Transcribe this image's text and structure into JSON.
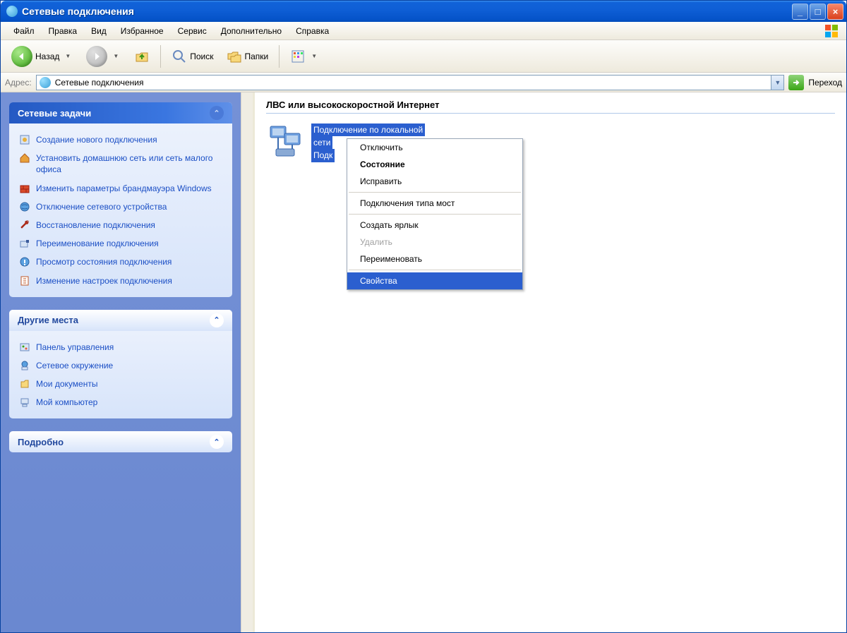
{
  "window": {
    "title": "Сетевые подключения"
  },
  "menu": {
    "items": [
      "Файл",
      "Правка",
      "Вид",
      "Избранное",
      "Сервис",
      "Дополнительно",
      "Справка"
    ]
  },
  "toolbar": {
    "back": "Назад",
    "search": "Поиск",
    "folders": "Папки"
  },
  "address": {
    "label": "Адрес:",
    "value": "Сетевые подключения",
    "go": "Переход"
  },
  "sidebar": {
    "panel1": {
      "title": "Сетевые задачи",
      "items": [
        "Создание нового подключения",
        "Установить домашнюю сеть или сеть малого офиса",
        "Изменить параметры брандмауэра Windows",
        "Отключение сетевого устройства",
        "Восстановление подключения",
        "Переименование подключения",
        "Просмотр состояния подключения",
        "Изменение настроек подключения"
      ]
    },
    "panel2": {
      "title": "Другие места",
      "items": [
        "Панель управления",
        "Сетевое окружение",
        "Мои документы",
        "Мой компьютер"
      ]
    },
    "panel3": {
      "title": "Подробно"
    }
  },
  "content": {
    "section": "ЛВС или высокоскоростной Интернет",
    "connection": {
      "line1": "Подключение по локальной",
      "line2": "сети",
      "line3": "Подк"
    }
  },
  "contextMenu": {
    "items": [
      {
        "label": "Отключить",
        "type": "normal"
      },
      {
        "label": "Состояние",
        "type": "bold"
      },
      {
        "label": "Исправить",
        "type": "normal"
      },
      {
        "label": "",
        "type": "sep"
      },
      {
        "label": "Подключения типа мост",
        "type": "normal"
      },
      {
        "label": "",
        "type": "sep"
      },
      {
        "label": "Создать ярлык",
        "type": "normal"
      },
      {
        "label": "Удалить",
        "type": "disabled"
      },
      {
        "label": "Переименовать",
        "type": "normal"
      },
      {
        "label": "",
        "type": "sep"
      },
      {
        "label": "Свойства",
        "type": "selected"
      }
    ]
  }
}
